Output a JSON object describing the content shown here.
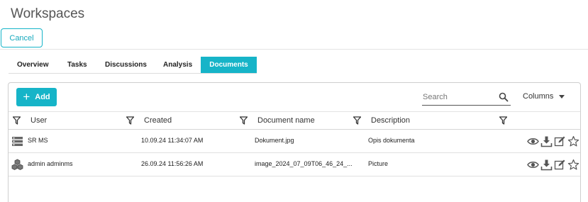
{
  "header": {
    "title": "Workspaces"
  },
  "toolbar": {
    "cancel_label": "Cancel"
  },
  "tabs": [
    {
      "label": "Overview",
      "active": false
    },
    {
      "label": "Tasks",
      "active": false
    },
    {
      "label": "Discussions",
      "active": false
    },
    {
      "label": "Analysis",
      "active": false
    },
    {
      "label": "Documents",
      "active": true
    }
  ],
  "grid": {
    "add_label": "Add",
    "search_placeholder": "Search",
    "columns_label": "Columns",
    "headers": [
      "User",
      "Created",
      "Document name",
      "Description"
    ],
    "rows": [
      {
        "user": "SR MS",
        "user_icon": "server-icon",
        "created": "10.09.24 11:34:07 AM",
        "document": "Dokument.jpg",
        "description": "Opis dokumenta"
      },
      {
        "user": "admin adminms",
        "user_icon": "cubes-icon",
        "created": "26.09.24 11:56:26 AM",
        "document": "image_2024_07_09T06_46_24_...",
        "description": "Picture"
      }
    ],
    "row_actions": [
      "view-icon",
      "download-icon",
      "edit-icon",
      "favorite-icon"
    ]
  },
  "colors": {
    "accent": "#16b4c8",
    "text": "#333333",
    "border": "#cfcfcf"
  }
}
